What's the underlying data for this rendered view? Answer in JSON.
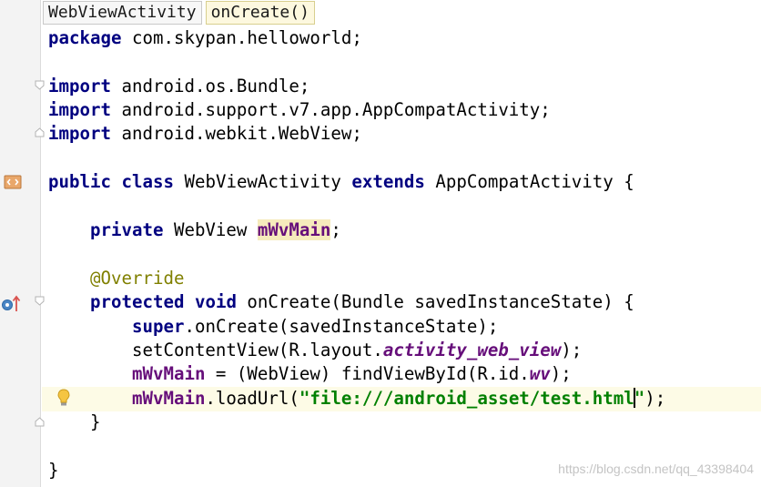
{
  "breadcrumb": {
    "class_name": "WebViewActivity",
    "method_name": "onCreate()"
  },
  "code": {
    "package_kw": "package",
    "package_name": " com.skypan.helloworld;",
    "import_kw": "import",
    "import1": " android.os.Bundle;",
    "import2": " android.support.v7.app.AppCompatActivity;",
    "import3": " android.webkit.WebView;",
    "public_kw": "public",
    "class_kw": "class",
    "class_name": " WebViewActivity ",
    "extends_kw": "extends",
    "super_class": " AppCompatActivity {",
    "indent4": "    ",
    "indent8": "        ",
    "private_kw": "private",
    "field_type": " WebView ",
    "field_name": "mWvMain",
    "semicolon": ";",
    "annotation": "@Override",
    "protected_kw": "protected",
    "void_kw": "void",
    "method_sig": " onCreate(Bundle savedInstanceState) {",
    "super_kw": "super",
    "super_call": ".onCreate(savedInstanceState);",
    "set_content_a": "setContentView(R.layout.",
    "layout_id": "activity_web_view",
    "set_content_b": ");",
    "assign_mid": " = (WebView) findViewById(R.id.",
    "view_id": "wv",
    "assign_end": ");",
    "load_mid": ".loadUrl(",
    "url_str_a": "\"file:///android_asset/test.html",
    "url_str_b": "\"",
    "load_end": ");",
    "close_method": "    }",
    "close_class": "}"
  },
  "watermark": "https://blog.csdn.net/qq_43398404",
  "icons": {
    "class_gutter": "java-class-icon",
    "override_gutter": "override-method-icon",
    "intention": "lightbulb-icon",
    "fold": "fold-marker-icon"
  },
  "colors": {
    "keyword": "#000080",
    "string": "#008000",
    "annotation": "#808000",
    "field": "#660e7a",
    "caret_line": "#fdfbe6"
  }
}
